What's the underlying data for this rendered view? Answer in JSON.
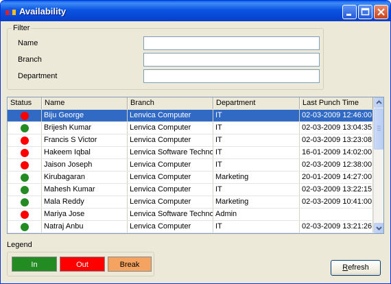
{
  "window": {
    "title": "Availability"
  },
  "filter": {
    "legend": "Filter",
    "name_label": "Name",
    "branch_label": "Branch",
    "department_label": "Department",
    "name_value": "",
    "branch_value": "",
    "department_value": ""
  },
  "grid": {
    "columns": [
      "Status",
      "Name",
      "Branch",
      "Department",
      "Last Punch Time"
    ],
    "selected_row": 0,
    "rows": [
      {
        "status": "out",
        "name": "Biju George",
        "branch": "Lenvica Computer",
        "department": "IT",
        "time": "02-03-2009 12:46:00"
      },
      {
        "status": "in",
        "name": "Brijesh Kumar",
        "branch": "Lenvica Computer",
        "department": "IT",
        "time": "02-03-2009 13:04:35"
      },
      {
        "status": "out",
        "name": "Francis S  Victor",
        "branch": "Lenvica Computer",
        "department": "IT",
        "time": "02-03-2009 13:23:08"
      },
      {
        "status": "out",
        "name": "Hakeem Iqbal",
        "branch": "Lenvica Software Techno",
        "department": "IT",
        "time": "16-01-2009 14:02:00"
      },
      {
        "status": "out",
        "name": "Jaison Joseph",
        "branch": "Lenvica Computer",
        "department": "IT",
        "time": "02-03-2009 12:38:00"
      },
      {
        "status": "in",
        "name": "Kirubagaran",
        "branch": "Lenvica Computer",
        "department": "Marketing",
        "time": "20-01-2009 14:27:00"
      },
      {
        "status": "in",
        "name": "Mahesh Kumar",
        "branch": "Lenvica Computer",
        "department": "IT",
        "time": "02-03-2009 13:22:15"
      },
      {
        "status": "in",
        "name": "Mala Reddy",
        "branch": "Lenvica Computer",
        "department": "Marketing",
        "time": "02-03-2009 10:41:00"
      },
      {
        "status": "out",
        "name": "Mariya Jose",
        "branch": "Lenvica Software Techno",
        "department": "Admin",
        "time": ""
      },
      {
        "status": "in",
        "name": "Natraj Anbu",
        "branch": "Lenvica Computer",
        "department": "IT",
        "time": "02-03-2009 13:21:26"
      }
    ]
  },
  "legend": {
    "title": "Legend",
    "in_label": "In",
    "out_label": "Out",
    "break_label": "Break"
  },
  "refresh": {
    "first_letter": "R",
    "rest": "efresh"
  },
  "colors": {
    "in": "#228b22",
    "out": "#ff0000",
    "break": "#f4a460",
    "selection": "#316ac5"
  }
}
